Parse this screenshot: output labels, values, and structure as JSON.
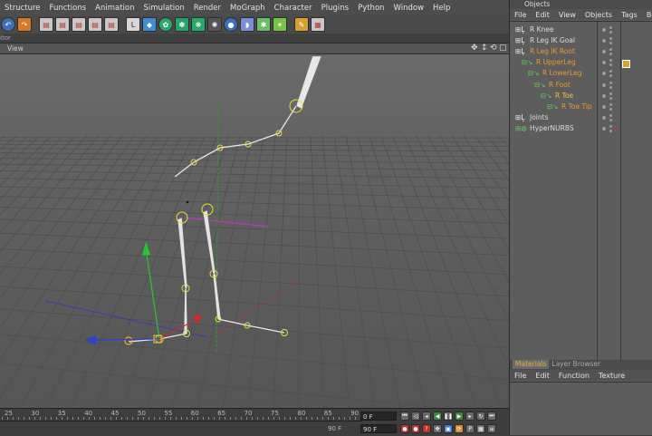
{
  "menubar": {
    "items": [
      "Structure",
      "Functions",
      "Animation",
      "Simulation",
      "Render",
      "MoGraph",
      "Character",
      "Plugins",
      "Python",
      "Window",
      "Help"
    ]
  },
  "editor": {
    "label": "itor"
  },
  "viewport": {
    "label": "View"
  },
  "objects": {
    "title": "Objects",
    "menu": [
      "File",
      "Edit",
      "View",
      "Objects",
      "Tags",
      "Bo"
    ],
    "rows": [
      {
        "label": "R Knee",
        "indent": 0,
        "color": "#dcdcdc"
      },
      {
        "label": "R Leg IK Goal",
        "indent": 0,
        "color": "#dcdcdc"
      },
      {
        "label": "R Leg IK Root",
        "indent": 0,
        "color": "#e69a2e"
      },
      {
        "label": "R UpperLeg",
        "indent": 1,
        "color": "#e69a2e"
      },
      {
        "label": "R LowerLeg",
        "indent": 2,
        "color": "#e69a2e"
      },
      {
        "label": "R Foot",
        "indent": 3,
        "color": "#e69a2e"
      },
      {
        "label": "R Toe",
        "indent": 4,
        "color": "#f2c040"
      },
      {
        "label": "R Toe Tip",
        "indent": 5,
        "color": "#e69a2e"
      },
      {
        "label": "Joints",
        "indent": 0,
        "color": "#dcdcdc"
      },
      {
        "label": "HyperNURBS",
        "indent": 0,
        "color": "#dcdcdc"
      }
    ]
  },
  "materials": {
    "tabs": [
      "Materials",
      "Layer Browser"
    ],
    "menu": [
      "File",
      "Edit",
      "Function",
      "Texture"
    ]
  },
  "timeline": {
    "ticks": [
      "25",
      "30",
      "35",
      "40",
      "45",
      "50",
      "55",
      "60",
      "65",
      "70",
      "75",
      "80",
      "85",
      "90"
    ],
    "current_frame": "0 F",
    "end_frame": "90 F",
    "end_frame_small": "90 F"
  }
}
